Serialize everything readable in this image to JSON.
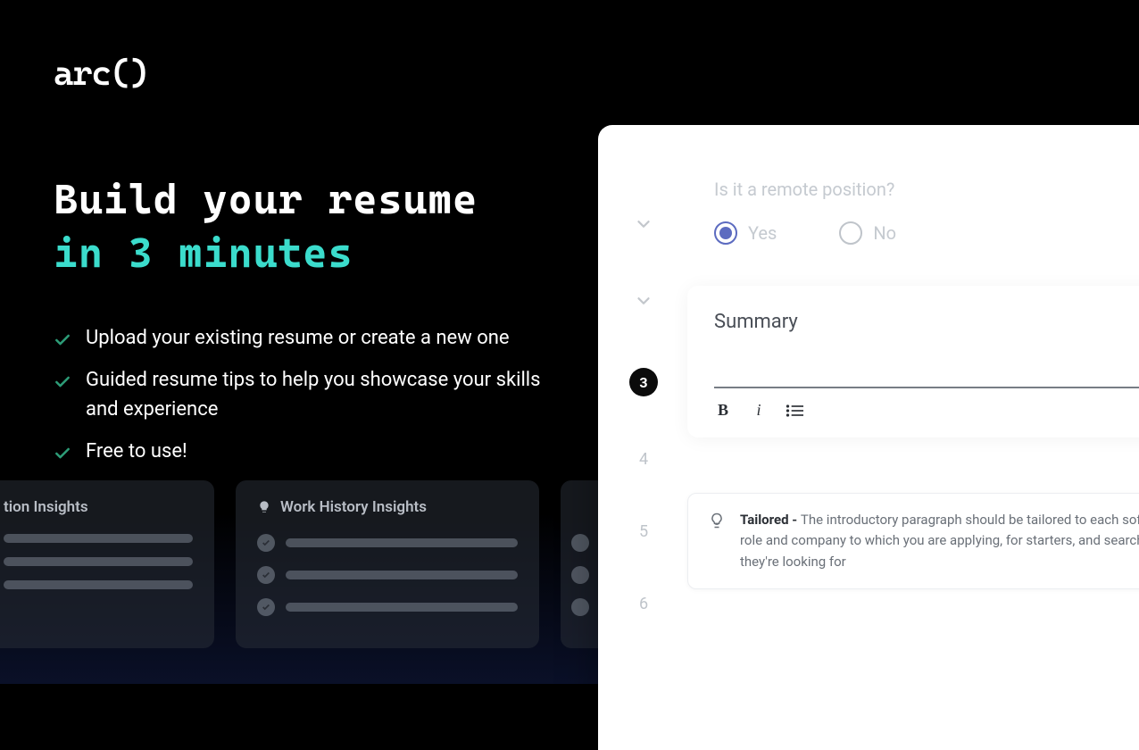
{
  "brand": {
    "logo": "arc()"
  },
  "hero": {
    "headline_line1": "Build your resume",
    "headline_line2": "in 3 minutes",
    "features": [
      "Upload your existing resume or create a new one",
      "Guided resume tips to help you showcase your skills and experience",
      "Free to use!"
    ]
  },
  "insight_cards": [
    {
      "title": "tion Insights"
    },
    {
      "title": "Work History Insights"
    },
    {
      "title": ""
    }
  ],
  "preview": {
    "steps": {
      "active": "3",
      "after": [
        "4",
        "5",
        "6"
      ]
    },
    "remote": {
      "question": "Is it a remote position?",
      "options": {
        "yes": "Yes",
        "no": "No"
      },
      "selected": "yes"
    },
    "summary": {
      "title": "Summary",
      "format_labels": {
        "bold": "B",
        "italic": "i"
      }
    },
    "tip": {
      "label": "Tailored - ",
      "text": "The introductory paragraph should be tailored to each soft role and company to which you are applying, for starters, and search t they're looking for"
    }
  }
}
